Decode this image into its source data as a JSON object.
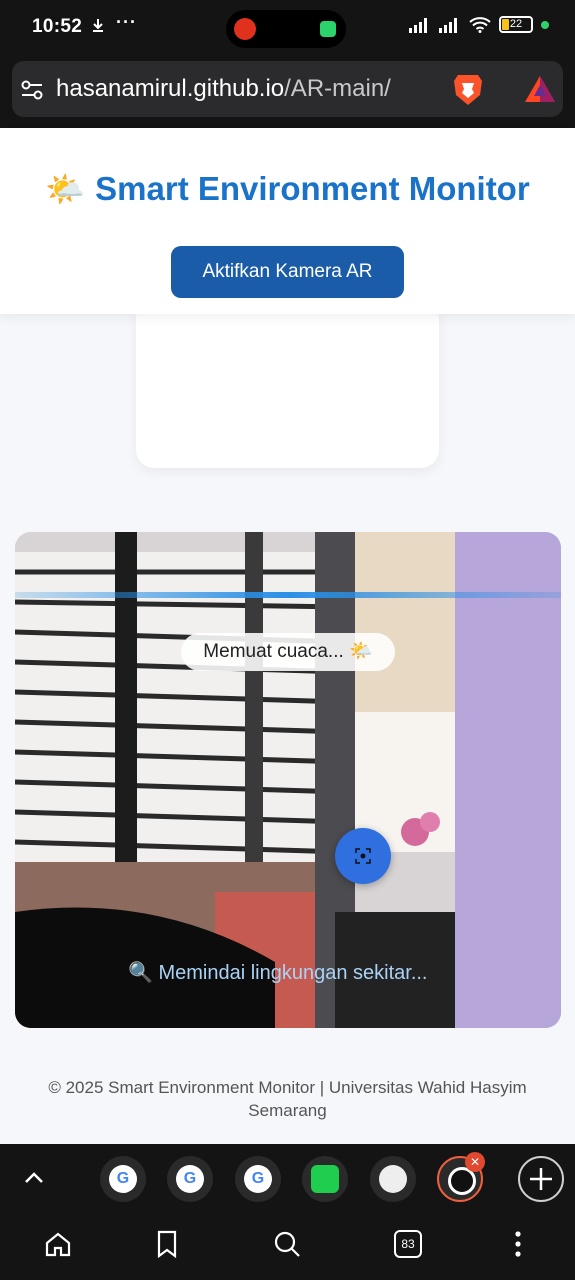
{
  "status_bar": {
    "time": "10:52",
    "battery": "22",
    "more_icon": "ellipsis-icon",
    "download_icon": "download-icon"
  },
  "address_bar": {
    "domain": "hasanamirul.github.io",
    "path": "/AR-main/",
    "site_settings_icon": "tune-icon",
    "shields_icon": "brave-lion-icon",
    "rewards_icon": "bat-triangle-icon"
  },
  "header": {
    "title_emoji": "🌤️",
    "title": "Smart Environment Monitor",
    "ar_button_label": "Aktifkan Kamera AR"
  },
  "camera": {
    "weather_status": "Memuat cuaca... 🌤️",
    "scan_status": "🔍 Memindai lingkungan sekitar..."
  },
  "footer": {
    "text": "© 2025 Smart Environment Monitor | Universitas Wahid Hasyim Semarang"
  },
  "tabs_bar": {
    "tabs": [
      {
        "icon": "google-icon",
        "glyph": "G"
      },
      {
        "icon": "google-icon",
        "glyph": "G"
      },
      {
        "icon": "google-icon",
        "glyph": "G"
      },
      {
        "icon": "video-call-icon",
        "glyph": ""
      },
      {
        "icon": "bear-app-icon",
        "glyph": ""
      },
      {
        "icon": "globe-icon",
        "glyph": ""
      }
    ],
    "close_glyph": "✕"
  },
  "bottom_nav": {
    "tab_count": "83"
  },
  "colors": {
    "accent_blue": "#1a73c9",
    "button_blue": "#1a5ca8",
    "fab_blue": "#2f6fe0",
    "active_tab_ring": "#f0603c",
    "brave_orange": "#fb542b"
  }
}
